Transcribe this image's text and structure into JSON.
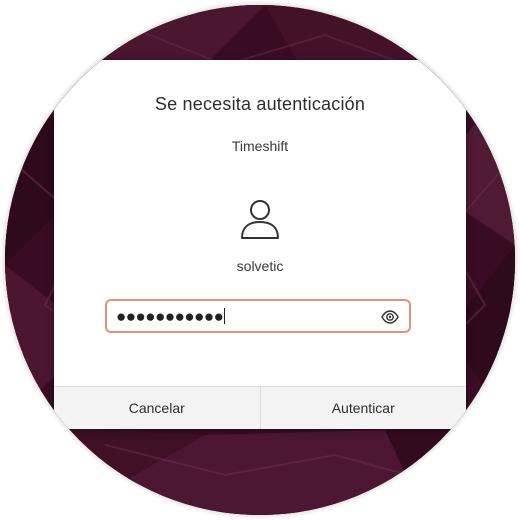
{
  "dialog": {
    "title": "Se necesita autenticación",
    "app_name": "Timeshift",
    "avatar_icon": "user-avatar-icon",
    "username": "solvetic",
    "password": {
      "masked_value": "●●●●●●●●●●●",
      "reveal_icon": "eye-icon",
      "focus_color": "#e9906f"
    },
    "buttons": {
      "cancel_label": "Cancelar",
      "confirm_label": "Autenticar"
    }
  },
  "colors": {
    "wallpaper_base": "#3b0d24",
    "dialog_background": "#ffffff",
    "button_background": "#f3f3f3"
  }
}
